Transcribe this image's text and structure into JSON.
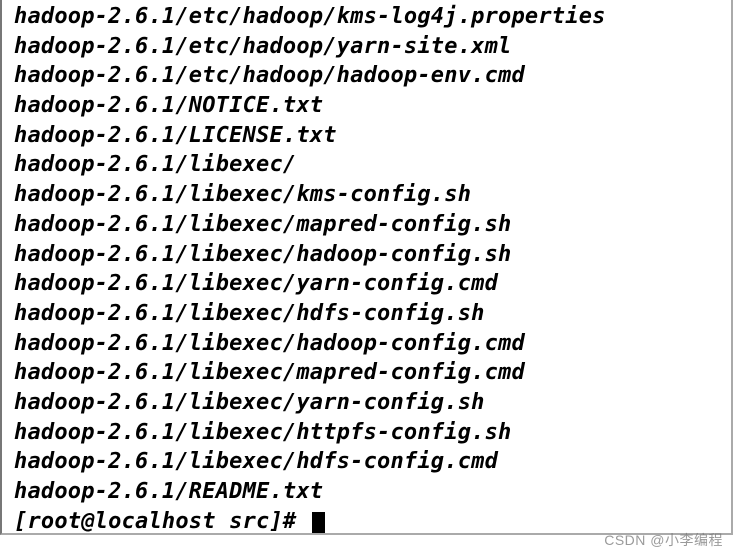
{
  "terminal": {
    "lines": [
      "hadoop-2.6.1/etc/hadoop/kms-log4j.properties",
      "hadoop-2.6.1/etc/hadoop/yarn-site.xml",
      "hadoop-2.6.1/etc/hadoop/hadoop-env.cmd",
      "hadoop-2.6.1/NOTICE.txt",
      "hadoop-2.6.1/LICENSE.txt",
      "hadoop-2.6.1/libexec/",
      "hadoop-2.6.1/libexec/kms-config.sh",
      "hadoop-2.6.1/libexec/mapred-config.sh",
      "hadoop-2.6.1/libexec/hadoop-config.sh",
      "hadoop-2.6.1/libexec/yarn-config.cmd",
      "hadoop-2.6.1/libexec/hdfs-config.sh",
      "hadoop-2.6.1/libexec/hadoop-config.cmd",
      "hadoop-2.6.1/libexec/mapred-config.cmd",
      "hadoop-2.6.1/libexec/yarn-config.sh",
      "hadoop-2.6.1/libexec/httpfs-config.sh",
      "hadoop-2.6.1/libexec/hdfs-config.cmd",
      "hadoop-2.6.1/README.txt"
    ],
    "prompt": "[root@localhost src]# "
  },
  "watermark": "CSDN @小李编程"
}
